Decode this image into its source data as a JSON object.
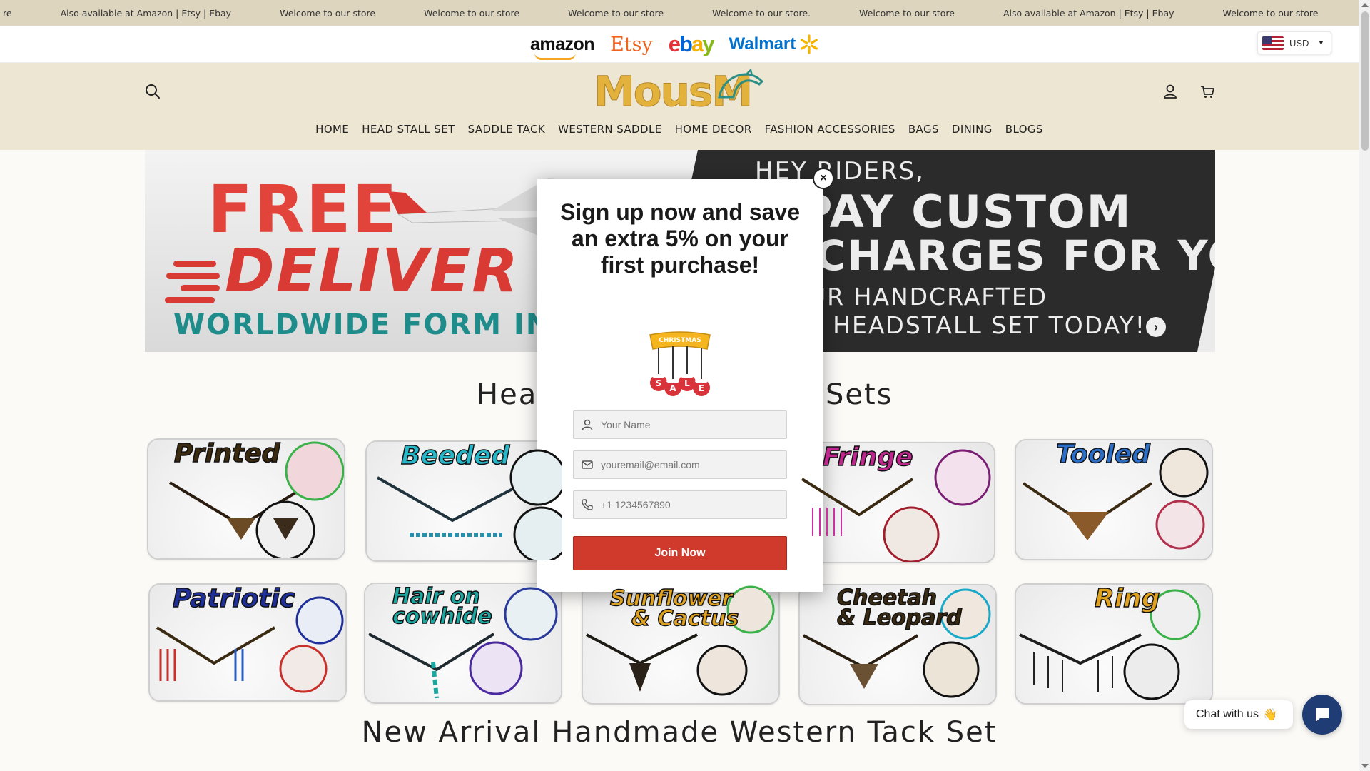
{
  "marquee": {
    "items": [
      "re",
      "Also available at Amazon | Etsy | Ebay",
      "Welcome to our store",
      "Welcome to our store",
      "Welcome to our store",
      "Welcome to our store.",
      "Welcome to our store",
      "Also available at Amazon | Etsy | Ebay",
      "Welcome to our store",
      "Welc"
    ]
  },
  "marketplaces": {
    "amazon": "amazon",
    "etsy": "Etsy",
    "ebay": {
      "e": "e",
      "b": "b",
      "a": "a",
      "y": "y"
    },
    "walmart": "Walmart"
  },
  "currency": {
    "code": "USD"
  },
  "header": {
    "brand": "MousM"
  },
  "nav": {
    "items": [
      "HOME",
      "HEAD STALL SET",
      "SADDLE TACK",
      "WESTERN SADDLE",
      "HOME DECOR",
      "FASHION ACCESSORIES",
      "BAGS",
      "DINING",
      "BLOGS"
    ]
  },
  "hero": {
    "free": "FREE",
    "delivery": "DELIVER",
    "worldwide": "WORLDWIDE FORM IN",
    "hey": "HEY RIDERS,",
    "pay": "E PAY CUSTOM",
    "charges": "CHARGES FOR YOU",
    "handcrafted": "UR HANDCRAFTED",
    "today": "N HEADSTALL SET TODAY!"
  },
  "sections": {
    "categories_title_left": "Head",
    "categories_title_right": "Sets",
    "new_arrival_title": "New Arrival Handmade Western Tack Set"
  },
  "categories": [
    {
      "name": "Printed",
      "color": "#3b2a0e"
    },
    {
      "name": "Beeded",
      "color": "#27b7c9"
    },
    {
      "name": "Fringe",
      "color": "#c0278e"
    },
    {
      "name": "Tooled",
      "color": "#2b6fc9"
    },
    {
      "name": "Patriotic",
      "color": "#1f2f9a"
    },
    {
      "name": "Hair on",
      "name2": "cowhide",
      "color": "#1aa8a0"
    },
    {
      "name": "Sunflower",
      "name2": "& Cactus",
      "color": "#e0a21e"
    },
    {
      "name": "Cheetah",
      "name2": "& Leopard",
      "color": "#3a2a12"
    },
    {
      "name": "Ring",
      "color": "#e0a21e"
    }
  ],
  "modal": {
    "title": "Sign up now and save an extra 5% on your first purchase!",
    "badge_label": "CHRISTMAS",
    "badge_letters": [
      "S",
      "A",
      "L",
      "E"
    ],
    "name_placeholder": "Your Name",
    "email_placeholder": "youremail@email.com",
    "phone_placeholder": "+1 1234567890",
    "join_label": "Join Now",
    "close_label": "×"
  },
  "chat": {
    "label": "Chat with us",
    "emoji": "👋"
  },
  "colors": {
    "marquee_bg": "#ddd5be",
    "header_bg": "#ede6d2",
    "join_button": "#cf3a2d",
    "chat_button": "#1f3c74"
  }
}
